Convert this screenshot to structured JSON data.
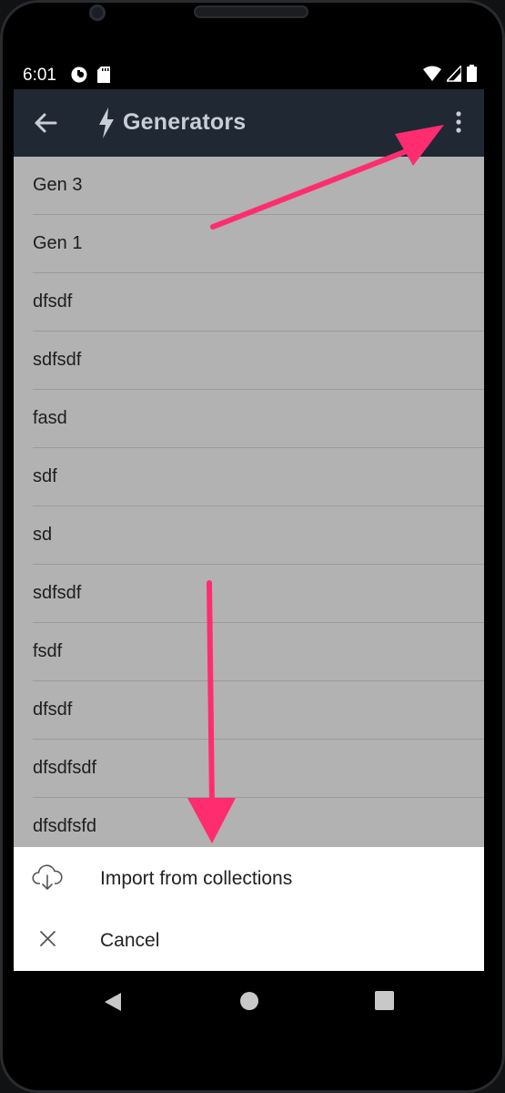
{
  "status_bar": {
    "time": "6:01"
  },
  "app_bar": {
    "title": "Generators",
    "back_icon": "arrow-left-icon",
    "title_icon": "lightning-bolt-icon",
    "menu_icon": "more-vertical-icon"
  },
  "list": {
    "items": [
      "Gen 3",
      "Gen 1",
      "dfsdf",
      "sdfsdf",
      "fasd",
      "sdf",
      "sd",
      "sdfsdf",
      "fsdf",
      "dfsdf",
      "dfsdfsdf",
      "dfsdfsfd"
    ]
  },
  "bottom_sheet": {
    "items": [
      {
        "label": "Import from collections",
        "icon": "cloud-download-icon"
      },
      {
        "label": "Cancel",
        "icon": "close-icon"
      }
    ]
  },
  "colors": {
    "app_bar": "#202833",
    "list_background": "#b2b2b2",
    "annotation_arrow": "#ff2d6f"
  }
}
